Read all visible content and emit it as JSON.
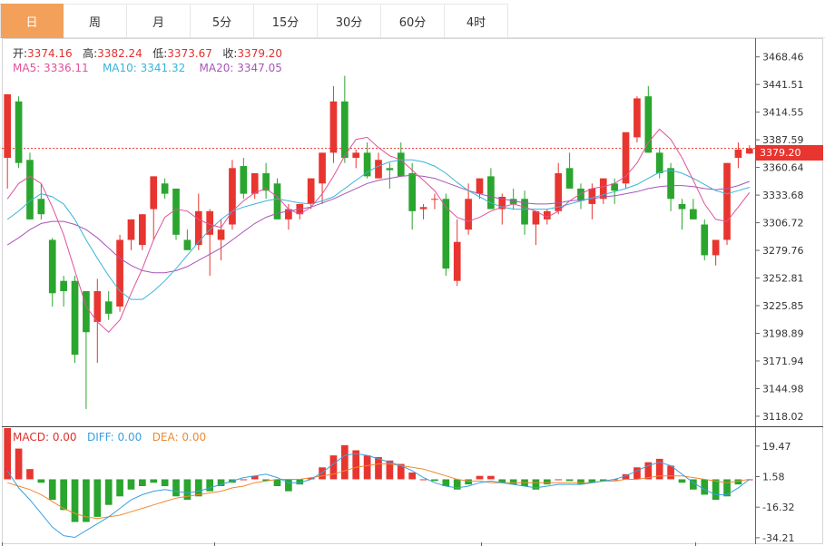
{
  "tabs": [
    {
      "label": "日",
      "active": true
    },
    {
      "label": "周",
      "active": false
    },
    {
      "label": "月",
      "active": false
    },
    {
      "label": "5分",
      "active": false
    },
    {
      "label": "15分",
      "active": false
    },
    {
      "label": "30分",
      "active": false
    },
    {
      "label": "60分",
      "active": false
    },
    {
      "label": "4时",
      "active": false
    }
  ],
  "ohlc": {
    "open_label": "开:",
    "open": "3374.16",
    "high_label": "高:",
    "high": "3382.24",
    "low_label": "低:",
    "low": "3373.67",
    "close_label": "收:",
    "close": "3379.20"
  },
  "ma": {
    "ma5": "MA5: 3336.11",
    "ma10": "MA10: 3341.32",
    "ma20": "MA20: 3347.05",
    "colors": {
      "ma5": "#e0529a",
      "ma10": "#3ab4d8",
      "ma20": "#a855b8"
    }
  },
  "current_price": "3379.20",
  "colors": {
    "up": "#e8352f",
    "down": "#2aa52e",
    "diff": "#3aa0e0",
    "dea": "#f08a30"
  },
  "chart_data": [
    {
      "type": "candlestick",
      "ylim": [
        3110,
        3485
      ],
      "y_ticks": [
        "3468.46",
        "3441.51",
        "3414.55",
        "3387.59",
        "3360.64",
        "3333.68",
        "3306.72",
        "3279.76",
        "3252.81",
        "3225.85",
        "3198.89",
        "3171.94",
        "3144.98",
        "3118.02"
      ],
      "candles": [
        [
          3370,
          3432,
          3340,
          3432
        ],
        [
          3425,
          3430,
          3360,
          3365
        ],
        [
          3368,
          3375,
          3310,
          3310
        ],
        [
          3330,
          3345,
          3310,
          3315
        ],
        [
          3290,
          3292,
          3225,
          3238
        ],
        [
          3250,
          3255,
          3225,
          3240
        ],
        [
          3250,
          3255,
          3170,
          3178
        ],
        [
          3240,
          3240,
          3125,
          3200
        ],
        [
          3210,
          3252,
          3170,
          3240
        ],
        [
          3230,
          3240,
          3212,
          3218
        ],
        [
          3225,
          3295,
          3220,
          3290
        ],
        [
          3290,
          3310,
          3280,
          3310
        ],
        [
          3285,
          3315,
          3280,
          3315
        ],
        [
          3320,
          3352,
          3290,
          3352
        ],
        [
          3345,
          3350,
          3330,
          3335
        ],
        [
          3340,
          3340,
          3290,
          3295
        ],
        [
          3290,
          3300,
          3280,
          3280
        ],
        [
          3285,
          3335,
          3280,
          3318
        ],
        [
          3295,
          3320,
          3255,
          3318
        ],
        [
          3290,
          3310,
          3270,
          3300
        ],
        [
          3305,
          3368,
          3300,
          3360
        ],
        [
          3362,
          3370,
          3330,
          3335
        ],
        [
          3335,
          3355,
          3330,
          3355
        ],
        [
          3355,
          3365,
          3330,
          3338
        ],
        [
          3345,
          3350,
          3310,
          3310
        ],
        [
          3310,
          3325,
          3300,
          3320
        ],
        [
          3315,
          3325,
          3310,
          3325
        ],
        [
          3325,
          3350,
          3320,
          3350
        ],
        [
          3345,
          3375,
          3325,
          3375
        ],
        [
          3375,
          3440,
          3365,
          3425
        ],
        [
          3425,
          3450,
          3365,
          3370
        ],
        [
          3370,
          3378,
          3360,
          3375
        ],
        [
          3375,
          3385,
          3350,
          3352
        ],
        [
          3350,
          3375,
          3350,
          3368
        ],
        [
          3360,
          3365,
          3340,
          3358
        ],
        [
          3375,
          3385,
          3355,
          3352
        ],
        [
          3355,
          3365,
          3300,
          3318
        ],
        [
          3320,
          3325,
          3310,
          3322
        ],
        [
          3330,
          3335,
          3320,
          3330
        ],
        [
          3330,
          3335,
          3255,
          3262
        ],
        [
          3250,
          3310,
          3245,
          3288
        ],
        [
          3300,
          3345,
          3295,
          3330
        ],
        [
          3335,
          3350,
          3330,
          3350
        ],
        [
          3352,
          3360,
          3320,
          3320
        ],
        [
          3320,
          3335,
          3305,
          3332
        ],
        [
          3330,
          3340,
          3320,
          3325
        ],
        [
          3330,
          3338,
          3295,
          3305
        ],
        [
          3305,
          3315,
          3285,
          3318
        ],
        [
          3310,
          3320,
          3305,
          3318
        ],
        [
          3318,
          3365,
          3315,
          3355
        ],
        [
          3360,
          3375,
          3345,
          3340
        ],
        [
          3340,
          3345,
          3320,
          3328
        ],
        [
          3325,
          3345,
          3310,
          3340
        ],
        [
          3330,
          3350,
          3325,
          3350
        ],
        [
          3345,
          3350,
          3325,
          3338
        ],
        [
          3345,
          3395,
          3340,
          3395
        ],
        [
          3390,
          3430,
          3385,
          3428
        ],
        [
          3430,
          3440,
          3375,
          3375
        ],
        [
          3375,
          3380,
          3350,
          3355
        ],
        [
          3360,
          3365,
          3318,
          3330
        ],
        [
          3325,
          3330,
          3300,
          3320
        ],
        [
          3320,
          3330,
          3310,
          3310
        ],
        [
          3305,
          3310,
          3270,
          3275
        ],
        [
          3275,
          3285,
          3265,
          3290
        ],
        [
          3290,
          3365,
          3285,
          3365
        ],
        [
          3370,
          3385,
          3360,
          3378
        ],
        [
          3374.16,
          3382.24,
          3373.67,
          3379.2
        ]
      ],
      "ma5": [
        3330,
        3345,
        3352,
        3345,
        3322,
        3295,
        3260,
        3225,
        3210,
        3200,
        3212,
        3238,
        3262,
        3290,
        3312,
        3320,
        3318,
        3310,
        3305,
        3302,
        3318,
        3328,
        3336,
        3340,
        3332,
        3320,
        3315,
        3322,
        3335,
        3352,
        3372,
        3388,
        3390,
        3380,
        3372,
        3368,
        3358,
        3348,
        3338,
        3322,
        3312,
        3308,
        3312,
        3318,
        3322,
        3325,
        3322,
        3318,
        3312,
        3318,
        3328,
        3335,
        3340,
        3342,
        3345,
        3352,
        3365,
        3385,
        3398,
        3388,
        3370,
        3348,
        3325,
        3310,
        3308,
        3322,
        3336.11
      ],
      "ma10": [
        3310,
        3318,
        3328,
        3335,
        3332,
        3325,
        3310,
        3290,
        3272,
        3255,
        3240,
        3232,
        3232,
        3240,
        3250,
        3262,
        3275,
        3288,
        3300,
        3310,
        3318,
        3322,
        3325,
        3328,
        3330,
        3328,
        3326,
        3325,
        3328,
        3332,
        3340,
        3348,
        3356,
        3362,
        3366,
        3368,
        3368,
        3366,
        3362,
        3355,
        3346,
        3338,
        3332,
        3326,
        3322,
        3320,
        3320,
        3320,
        3320,
        3322,
        3325,
        3328,
        3331,
        3334,
        3337,
        3340,
        3344,
        3350,
        3356,
        3358,
        3355,
        3350,
        3344,
        3338,
        3335,
        3338,
        3341.32
      ],
      "ma20": [
        3285,
        3292,
        3300,
        3306,
        3308,
        3308,
        3305,
        3300,
        3292,
        3282,
        3272,
        3265,
        3260,
        3258,
        3258,
        3260,
        3264,
        3270,
        3276,
        3282,
        3290,
        3298,
        3306,
        3312,
        3316,
        3318,
        3320,
        3322,
        3326,
        3330,
        3335,
        3340,
        3345,
        3348,
        3350,
        3352,
        3353,
        3352,
        3350,
        3346,
        3342,
        3338,
        3335,
        3332,
        3330,
        3328,
        3326,
        3325,
        3325,
        3326,
        3328,
        3329,
        3330,
        3332,
        3333,
        3335,
        3337,
        3340,
        3342,
        3343,
        3343,
        3342,
        3340,
        3339,
        3340,
        3343,
        3347.05
      ]
    },
    {
      "type": "bar",
      "title": "MACD",
      "legend": {
        "macd": "MACD: 0.00",
        "diff": "DIFF: 0.00",
        "dea": "DEA: 0.00"
      },
      "ylim": [
        -38,
        30
      ],
      "y_ticks": [
        "19.47",
        "1.58",
        "-16.32",
        "-34.21"
      ],
      "macd": [
        30,
        18,
        6,
        -2,
        -12,
        -18,
        -25,
        -25,
        -22,
        -15,
        -10,
        -6,
        -4,
        -2,
        -4,
        -10,
        -12,
        -10,
        -7,
        -4,
        -2,
        0,
        2,
        -1,
        -4,
        -7,
        -3,
        1,
        7,
        14,
        20,
        17,
        14,
        13,
        11,
        9,
        4,
        0,
        -1,
        -4,
        -6,
        -3,
        2,
        2,
        -2,
        -3,
        -4,
        -6,
        -3,
        0,
        -1,
        -3,
        -2,
        -1,
        0,
        3,
        7,
        10,
        12,
        8,
        -2,
        -6,
        -9,
        -12,
        -10,
        -3,
        0
      ],
      "diff": [
        5,
        -5,
        -12,
        -20,
        -28,
        -33,
        -34,
        -30,
        -26,
        -22,
        -17,
        -12,
        -9,
        -7,
        -6,
        -7,
        -8,
        -7,
        -5,
        -3,
        -1,
        1,
        2,
        3,
        1,
        -2,
        -2,
        0,
        4,
        9,
        14,
        15,
        14,
        12,
        10,
        8,
        5,
        1,
        -2,
        -4,
        -5,
        -4,
        -2,
        -1,
        -2,
        -3,
        -4,
        -5,
        -4,
        -3,
        -3,
        -3,
        -2,
        -1,
        0,
        2,
        5,
        8,
        10,
        8,
        3,
        -2,
        -6,
        -9,
        -9,
        -5,
        0
      ],
      "dea": [
        -2,
        -4,
        -6,
        -9,
        -13,
        -17,
        -20,
        -22,
        -23,
        -22,
        -21,
        -19,
        -17,
        -15,
        -13,
        -11,
        -10,
        -9,
        -8,
        -7,
        -5,
        -4,
        -2,
        -1,
        0,
        0,
        0,
        1,
        2,
        3,
        5,
        7,
        8,
        9,
        9,
        8,
        7,
        6,
        4,
        2,
        0,
        -1,
        -1,
        -2,
        -2,
        -2,
        -2,
        -2,
        -2,
        -2,
        -2,
        -2,
        -2,
        -1,
        -1,
        0,
        0,
        1,
        2,
        2,
        2,
        1,
        0,
        -1,
        -2,
        -1,
        0
      ]
    }
  ]
}
